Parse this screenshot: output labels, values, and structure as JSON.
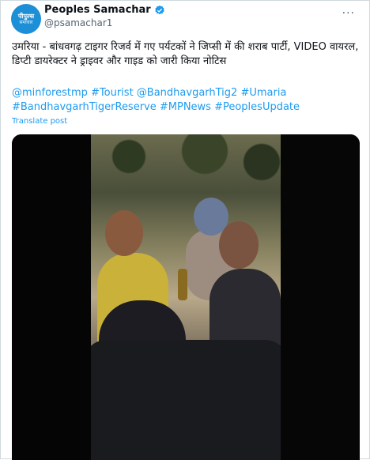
{
  "account": {
    "avatar_line1": "पीपुल्स",
    "avatar_line2": "समाचार",
    "name": "Peoples Samachar",
    "handle": "@psamachar1",
    "verified_icon": "verified-badge-icon"
  },
  "post": {
    "text": "उमरिया - बांधवगढ़ टाइगर रिजर्व में गए पर्यटकों ने जिप्सी में की शराब पार्टी, VIDEO वायरल, डिप्टी डायरेक्टर ने ड्राइवर और गाइड को जारी किया नोटिस",
    "hashtags": "@minforestmp #Tourist @BandhavgarhTig2 #Umaria #BandhavgarhTigerReserve #MPNews #PeoplesUpdate",
    "translate_label": "Translate post"
  },
  "more_icon": "more-options-icon",
  "colors": {
    "link": "#1d9bf0",
    "avatar_bg": "#1d8fd6",
    "secondary_text": "#536471"
  }
}
